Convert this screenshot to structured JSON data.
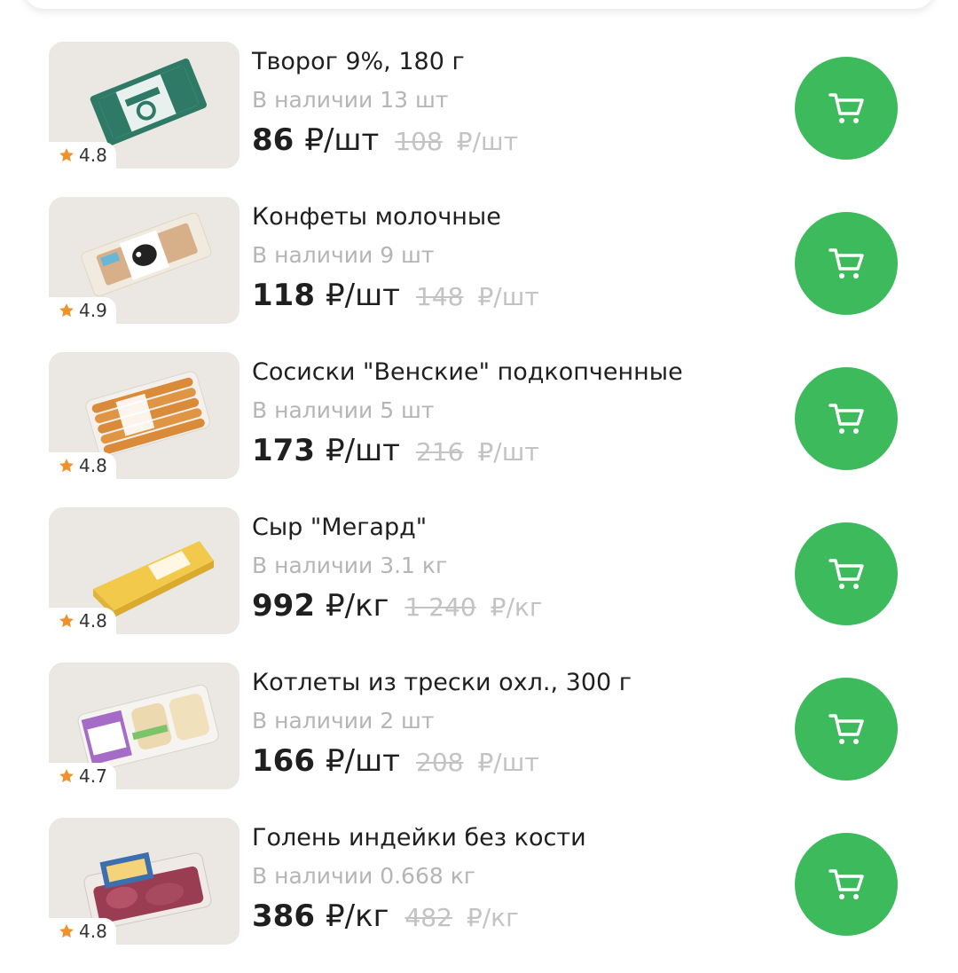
{
  "colors": {
    "accent_green": "#3cba5c",
    "star_orange": "#f0922b",
    "muted_text": "#b5b5b5"
  },
  "products": [
    {
      "title": "Творог 9%, 180 г",
      "stock": "В наличии 13 шт",
      "price": "86",
      "price_unit": "₽/шт",
      "old_price": "108",
      "old_unit": "₽/шт",
      "rating": "4.8",
      "icon": "cart-icon"
    },
    {
      "title": "Конфеты молочные",
      "stock": "В наличии 9 шт",
      "price": "118",
      "price_unit": "₽/шт",
      "old_price": "148",
      "old_unit": "₽/шт",
      "rating": "4.9",
      "icon": "cart-icon"
    },
    {
      "title": "Сосиски \"Венские\" подкопченные",
      "stock": "В наличии 5 шт",
      "price": "173",
      "price_unit": "₽/шт",
      "old_price": "216",
      "old_unit": "₽/шт",
      "rating": "4.8",
      "icon": "cart-icon"
    },
    {
      "title": "Сыр \"Мегард\"",
      "stock": "В наличии 3.1 кг",
      "price": "992",
      "price_unit": "₽/кг",
      "old_price": "1 240",
      "old_unit": "₽/кг",
      "rating": "4.8",
      "icon": "cart-icon"
    },
    {
      "title": "Котлеты из трески охл., 300 г",
      "stock": "В наличии 2 шт",
      "price": "166",
      "price_unit": "₽/шт",
      "old_price": "208",
      "old_unit": "₽/шт",
      "rating": "4.7",
      "icon": "cart-icon"
    },
    {
      "title": "Голень индейки без кости",
      "stock": "В наличии 0.668 кг",
      "price": "386",
      "price_unit": "₽/кг",
      "old_price": "482",
      "old_unit": "₽/кг",
      "rating": "4.8",
      "icon": "cart-icon"
    }
  ]
}
